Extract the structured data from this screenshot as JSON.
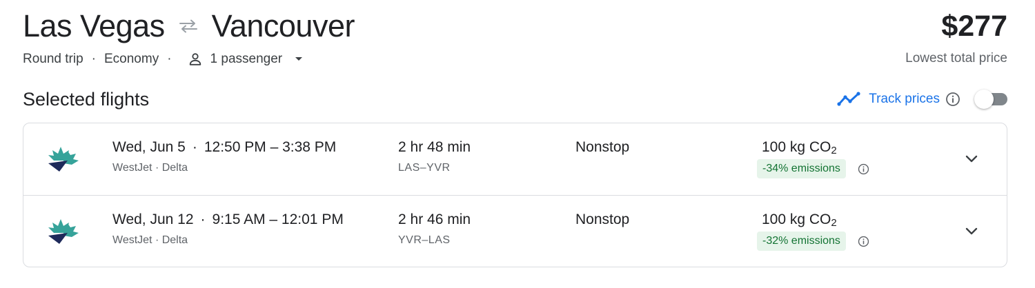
{
  "header": {
    "origin": "Las Vegas",
    "destination": "Vancouver",
    "trip_type": "Round trip",
    "cabin": "Economy",
    "passengers": "1 passenger",
    "price": "$277",
    "price_label": "Lowest total price"
  },
  "section": {
    "title": "Selected flights",
    "track_label": "Track prices"
  },
  "colors": {
    "accent": "#1a73e8",
    "emissions_green": "#137333",
    "emissions_bg": "#e6f4ea",
    "westjet_teal": "#36a39a",
    "westjet_navy": "#1e2a5a"
  },
  "flights": [
    {
      "date": "Wed, Jun 5",
      "time": "12:50 PM – 3:38 PM",
      "airlines": "WestJet · Delta",
      "duration": "2 hr 48 min",
      "airports": "LAS–YVR",
      "stops": "Nonstop",
      "co2_value": "100 kg CO",
      "co2_sub": "2",
      "emissions": "-34% emissions"
    },
    {
      "date": "Wed, Jun 12",
      "time": "9:15 AM – 12:01 PM",
      "airlines": "WestJet · Delta",
      "duration": "2 hr 46 min",
      "airports": "YVR–LAS",
      "stops": "Nonstop",
      "co2_value": "100 kg CO",
      "co2_sub": "2",
      "emissions": "-32% emissions"
    }
  ]
}
